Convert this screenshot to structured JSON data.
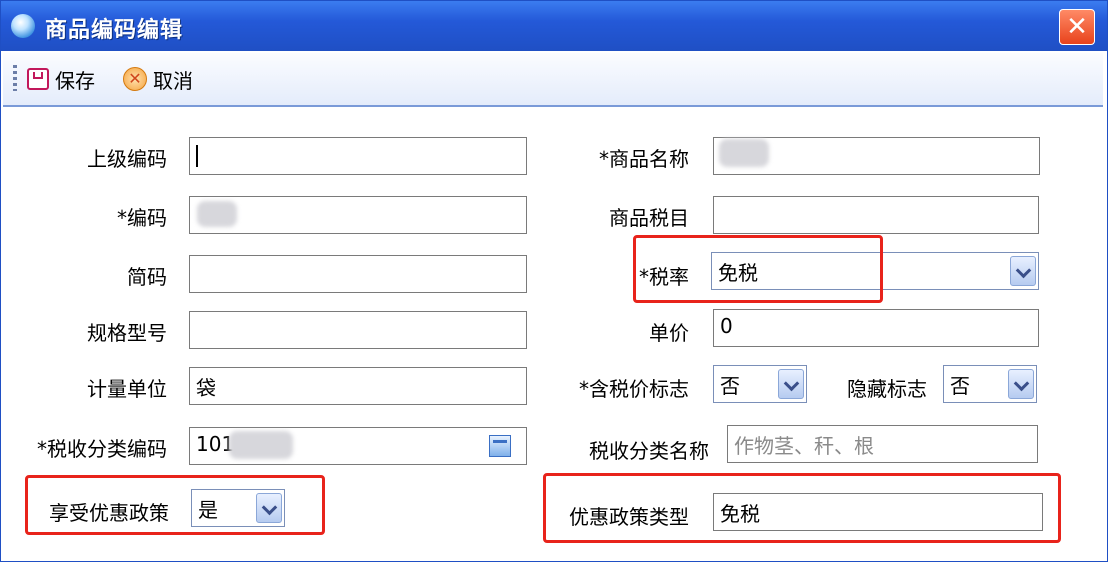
{
  "window": {
    "title": "商品编码编辑",
    "close_glyph": "✕"
  },
  "toolbar": {
    "save_label": "保存",
    "cancel_label": "取消"
  },
  "form": {
    "parent_code": {
      "label": "上级编码",
      "value": ""
    },
    "code": {
      "label": "*编码",
      "value": ""
    },
    "short_code": {
      "label": "简码",
      "value": ""
    },
    "spec_model": {
      "label": "规格型号",
      "value": ""
    },
    "unit": {
      "label": "计量单位",
      "value": "袋"
    },
    "tax_class_code": {
      "label": "*税收分类编码",
      "value": "101"
    },
    "enjoy_preferential": {
      "label": "享受优惠政策",
      "value": "是"
    },
    "product_name": {
      "label": "*商品名称",
      "value": ""
    },
    "tax_item": {
      "label": "商品税目",
      "value": ""
    },
    "tax_rate": {
      "label": "*税率",
      "value": "免税"
    },
    "unit_price": {
      "label": "单价",
      "value": "0"
    },
    "tax_included": {
      "label": "*含税价标志",
      "value": "否"
    },
    "hidden_flag": {
      "label": "隐藏标志",
      "value": "否"
    },
    "tax_class_name": {
      "label": "税收分类名称",
      "value": "作物茎、秆、根"
    },
    "preferential_type": {
      "label": "优惠政策类型",
      "value": "免税"
    }
  },
  "colors": {
    "title_bar": "#1f4fc4",
    "highlight": "#e8231b",
    "close_button": "#e8431c"
  },
  "icons": [
    "app-logo-icon",
    "close-icon",
    "save-icon",
    "cancel-icon",
    "chevron-down-icon",
    "browse-icon"
  ]
}
